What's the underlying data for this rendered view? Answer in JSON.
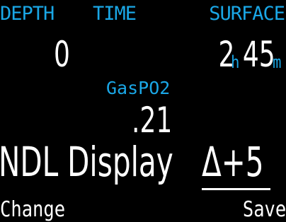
{
  "header": {
    "depth_label": "DEPTH",
    "time_label": "TIME",
    "surface_label": "SURFACE"
  },
  "depth": {
    "value": "0"
  },
  "surface": {
    "hours": "2",
    "hours_unit": "h",
    "minutes": "45",
    "minutes_unit": "m"
  },
  "gas": {
    "label": "GasPO2",
    "value": ".21"
  },
  "setting": {
    "label": "NDL Display",
    "value": "Δ+5"
  },
  "softkeys": {
    "left": "Change",
    "right": "Save"
  },
  "colors": {
    "background": "#000000",
    "label": "#1aa7e6",
    "value": "#ffffff"
  }
}
